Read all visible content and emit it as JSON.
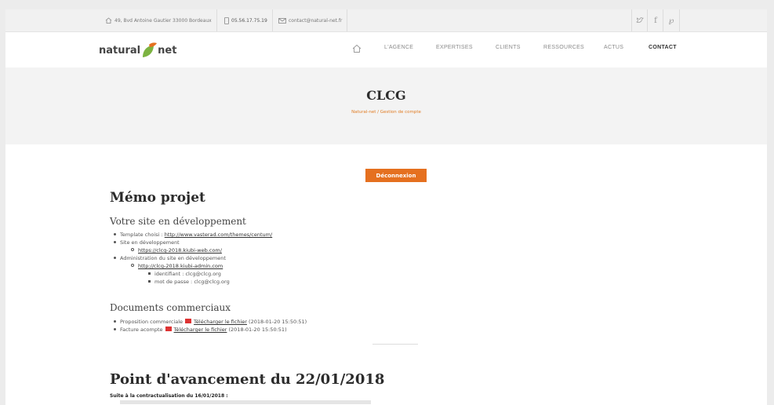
{
  "topbar": {
    "address": "49, Bvd Antoine Gautier 33000 Bordeaux",
    "phone": "05.56.17.75.19",
    "email": "contact@natural-net.fr",
    "social": [
      "twitter-icon",
      "facebook-icon",
      "pinterest-icon"
    ]
  },
  "brand": {
    "word1": "natural",
    "word2": "net",
    "accent": "#7cb341",
    "accent2": "#e5701f"
  },
  "nav": {
    "items": [
      "L'AGENCE",
      "EXPERTISES",
      "CLIENTS",
      "RESSOURCES",
      "ACTUS",
      "CONTACT"
    ],
    "active": "CONTACT"
  },
  "page": {
    "title": "CLCG",
    "breadcrumb": "Natural-net / Gestion de compte"
  },
  "content": {
    "logout": "Déconnexion",
    "memo_title": "Mémo projet",
    "dev_title": "Votre site en développement",
    "template_label": "Template choisi : ",
    "template_link": "http://www.vasterad.com/themes/centum/",
    "site_dev_label": "Site en développement",
    "site_dev_link": "https://clcg-2018.kiubi-web.com/",
    "admin_label": "Administration du site en développement",
    "admin_link": "http://clcg-2018.kiubi-admin.com",
    "identifiant": "identifiant : clcg@clcg.org",
    "password": "mot de passe : clcg@clcg.org",
    "docs_title": "Documents commerciaux",
    "doc1_label": "Proposition commerciale",
    "doc1_link": "Télécharger le fichier",
    "doc1_date": "(2018-01-20 15:50:51)",
    "doc2_label": "Facture acompte",
    "doc2_link": "Télécharger le fichier",
    "doc2_date": "(2018-01-20 15:50:51)",
    "progress_title": "Point d'avancement du 22/01/2018",
    "progress_note": "Suite à la contractualisation du 16/01/2018 :"
  }
}
